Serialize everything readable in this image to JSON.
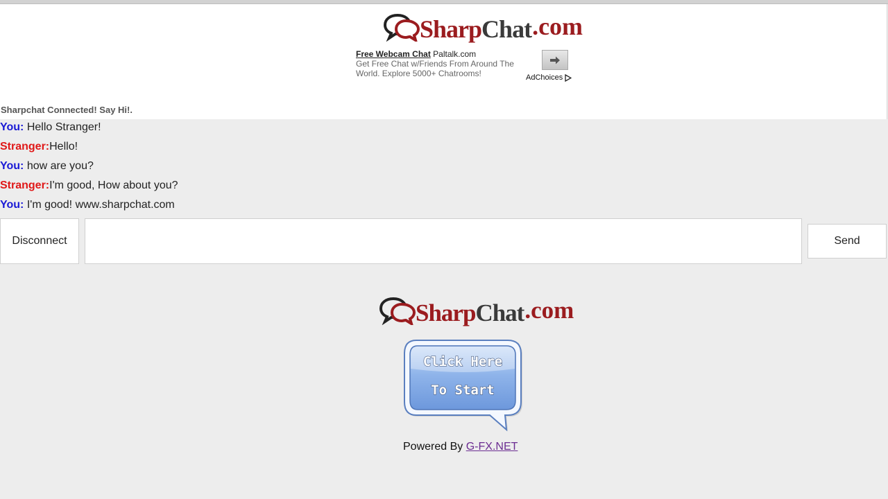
{
  "brand": {
    "name_part1": "Sharp",
    "name_part2": "Chat",
    "tld": ".com"
  },
  "ad": {
    "link_text": "Free Webcam Chat",
    "domain": "Paltalk.com",
    "description": "Get Free Chat w/Friends From Around The World. Explore 5000+ Chatrooms!",
    "adchoices_label": "AdChoices"
  },
  "status_text": "Sharpchat Connected! Say Hi!.",
  "messages": [
    {
      "speaker": "You:",
      "text": "Hello Stranger!"
    },
    {
      "speaker": "Stranger:",
      "text": "Hello!"
    },
    {
      "speaker": "You:",
      "text": "how are you?"
    },
    {
      "speaker": "Stranger:",
      "text": "I'm good, How about you?"
    },
    {
      "speaker": "You:",
      "text": "I'm good! www.sharpchat.com"
    }
  ],
  "controls": {
    "disconnect_label": "Disconnect",
    "send_label": "Send",
    "input_value": ""
  },
  "start_button": {
    "line1": "Click Here",
    "line2": "To Start"
  },
  "footer": {
    "powered_by": "Powered By",
    "link_text": "G-FX.NET"
  },
  "colors": {
    "you": "#1a1ad6",
    "stranger": "#e01818",
    "brand_red": "#9b1c1f",
    "link_purple": "#6b2c91"
  }
}
